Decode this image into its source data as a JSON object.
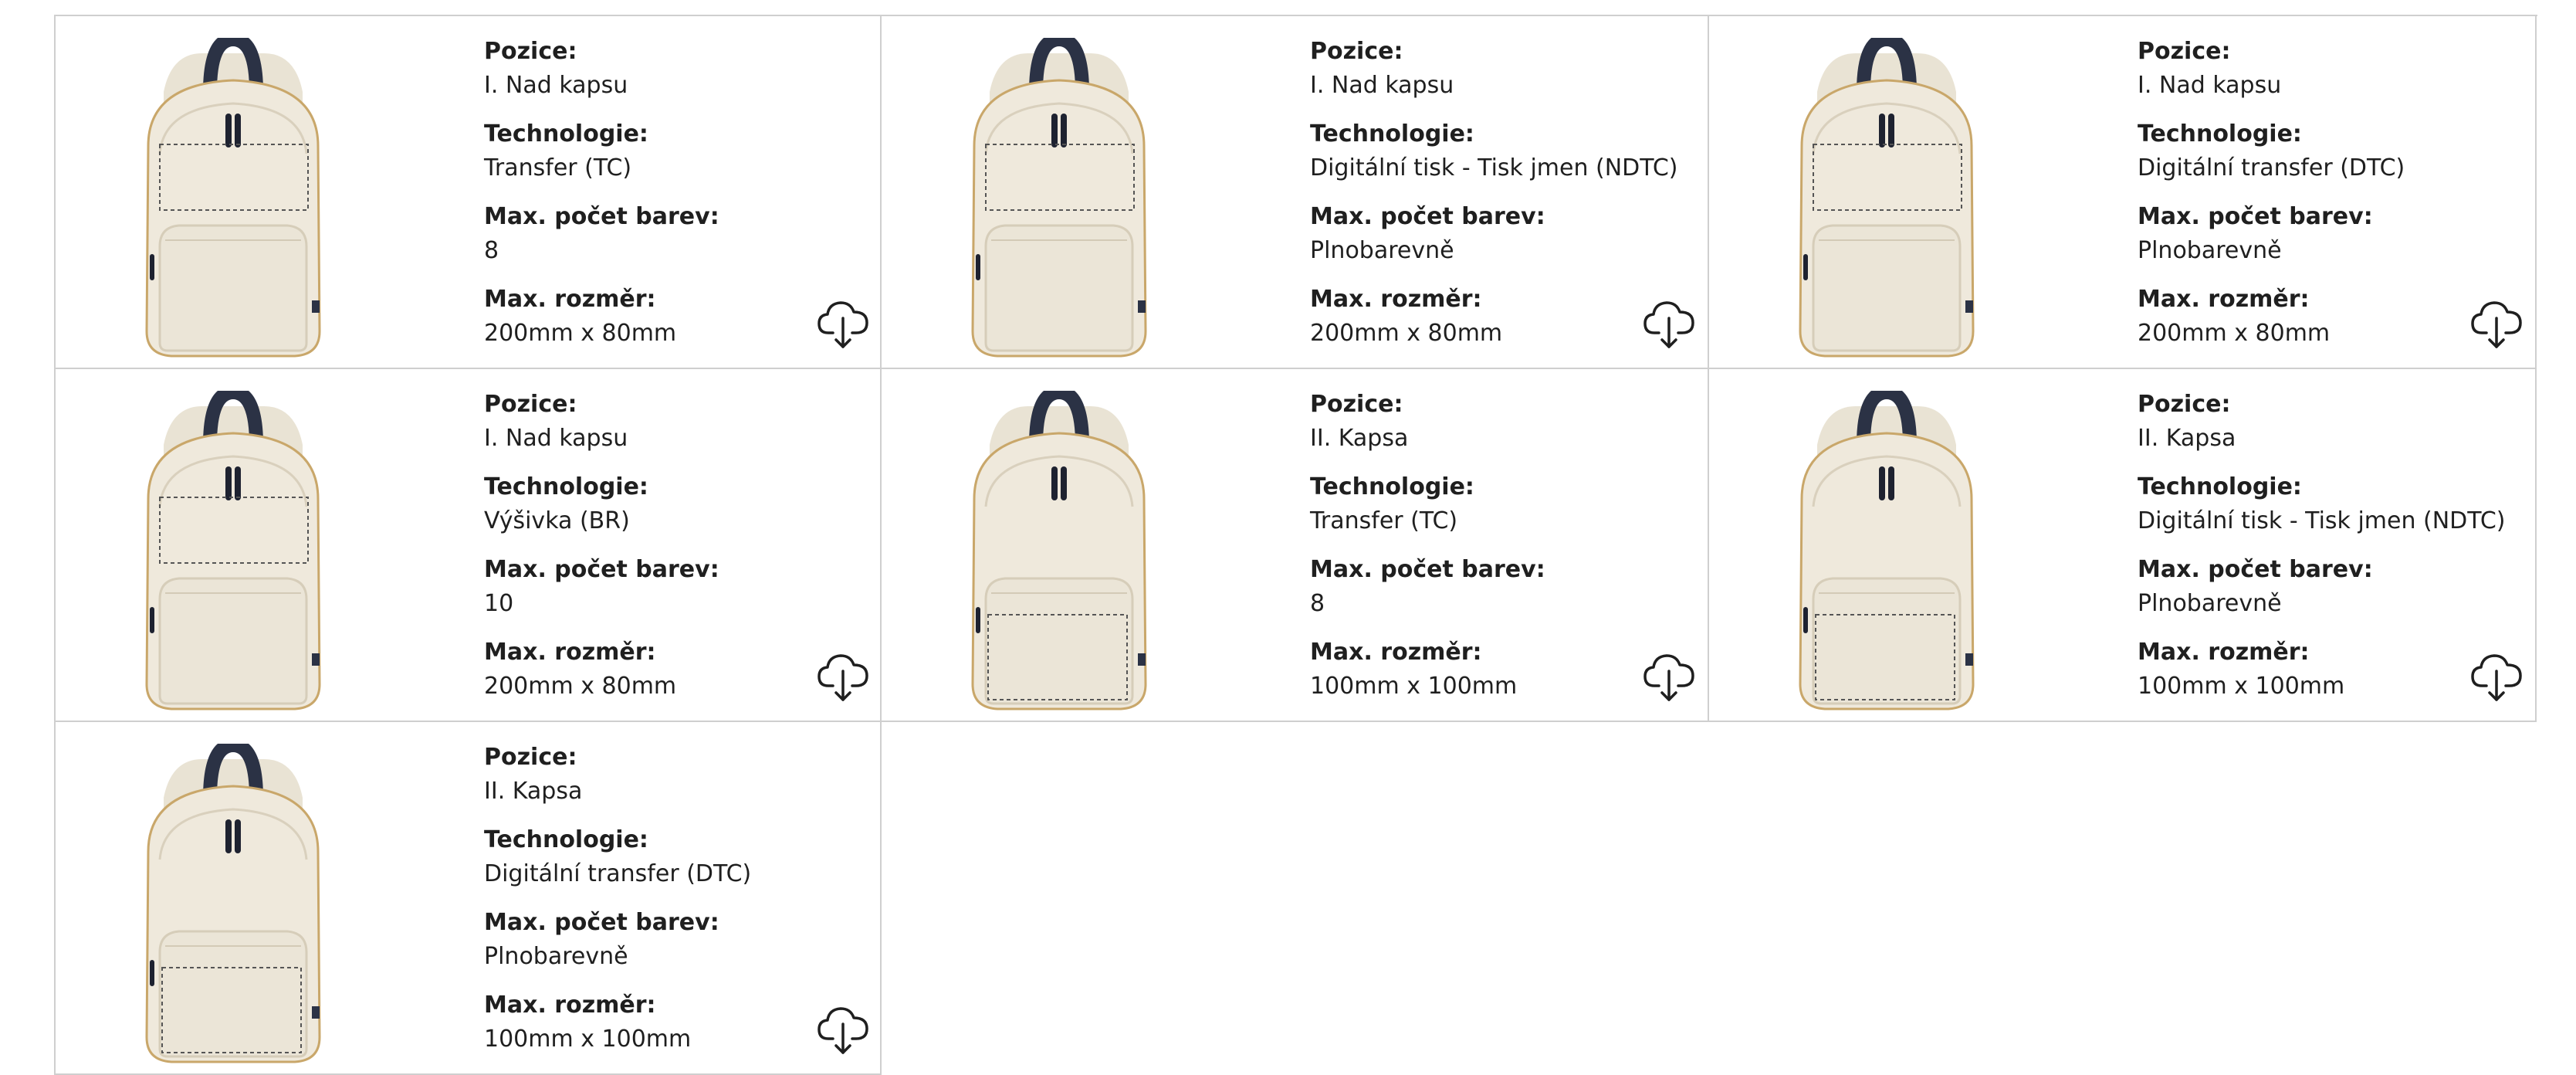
{
  "labels": {
    "position": "Pozice:",
    "technology": "Technologie:",
    "max_colors": "Max. počet barev:",
    "max_size": "Max. rozměr:"
  },
  "icons": {
    "download": "cloud-download-icon",
    "product": "backpack-image"
  },
  "colors": {
    "border": "#cfcfcf",
    "backpack": "#efe9dc",
    "strap": "#2b3245"
  },
  "cards": [
    {
      "position": "I. Nad kapsu",
      "technology": "Transfer (TC)",
      "max_colors": "8",
      "max_size": "200mm x 80mm",
      "area": "top"
    },
    {
      "position": "I. Nad kapsu",
      "technology": "Digitální tisk - Tisk jmen (NDTC)",
      "max_colors": "Plnobarevně",
      "max_size": "200mm x 80mm",
      "area": "top"
    },
    {
      "position": "I. Nad kapsu",
      "technology": "Digitální transfer (DTC)",
      "max_colors": "Plnobarevně",
      "max_size": "200mm x 80mm",
      "area": "top"
    },
    {
      "position": "I. Nad kapsu",
      "technology": "Výšivka (BR)",
      "max_colors": "10",
      "max_size": "200mm x 80mm",
      "area": "top"
    },
    {
      "position": "II. Kapsa",
      "technology": "Transfer (TC)",
      "max_colors": "8",
      "max_size": "100mm x 100mm",
      "area": "pocket"
    },
    {
      "position": "II. Kapsa",
      "technology": "Digitální tisk - Tisk jmen (NDTC)",
      "max_colors": "Plnobarevně",
      "max_size": "100mm x 100mm",
      "area": "pocket"
    },
    {
      "position": "II. Kapsa",
      "technology": "Digitální transfer (DTC)",
      "max_colors": "Plnobarevně",
      "max_size": "100mm x 100mm",
      "area": "pocket"
    }
  ]
}
